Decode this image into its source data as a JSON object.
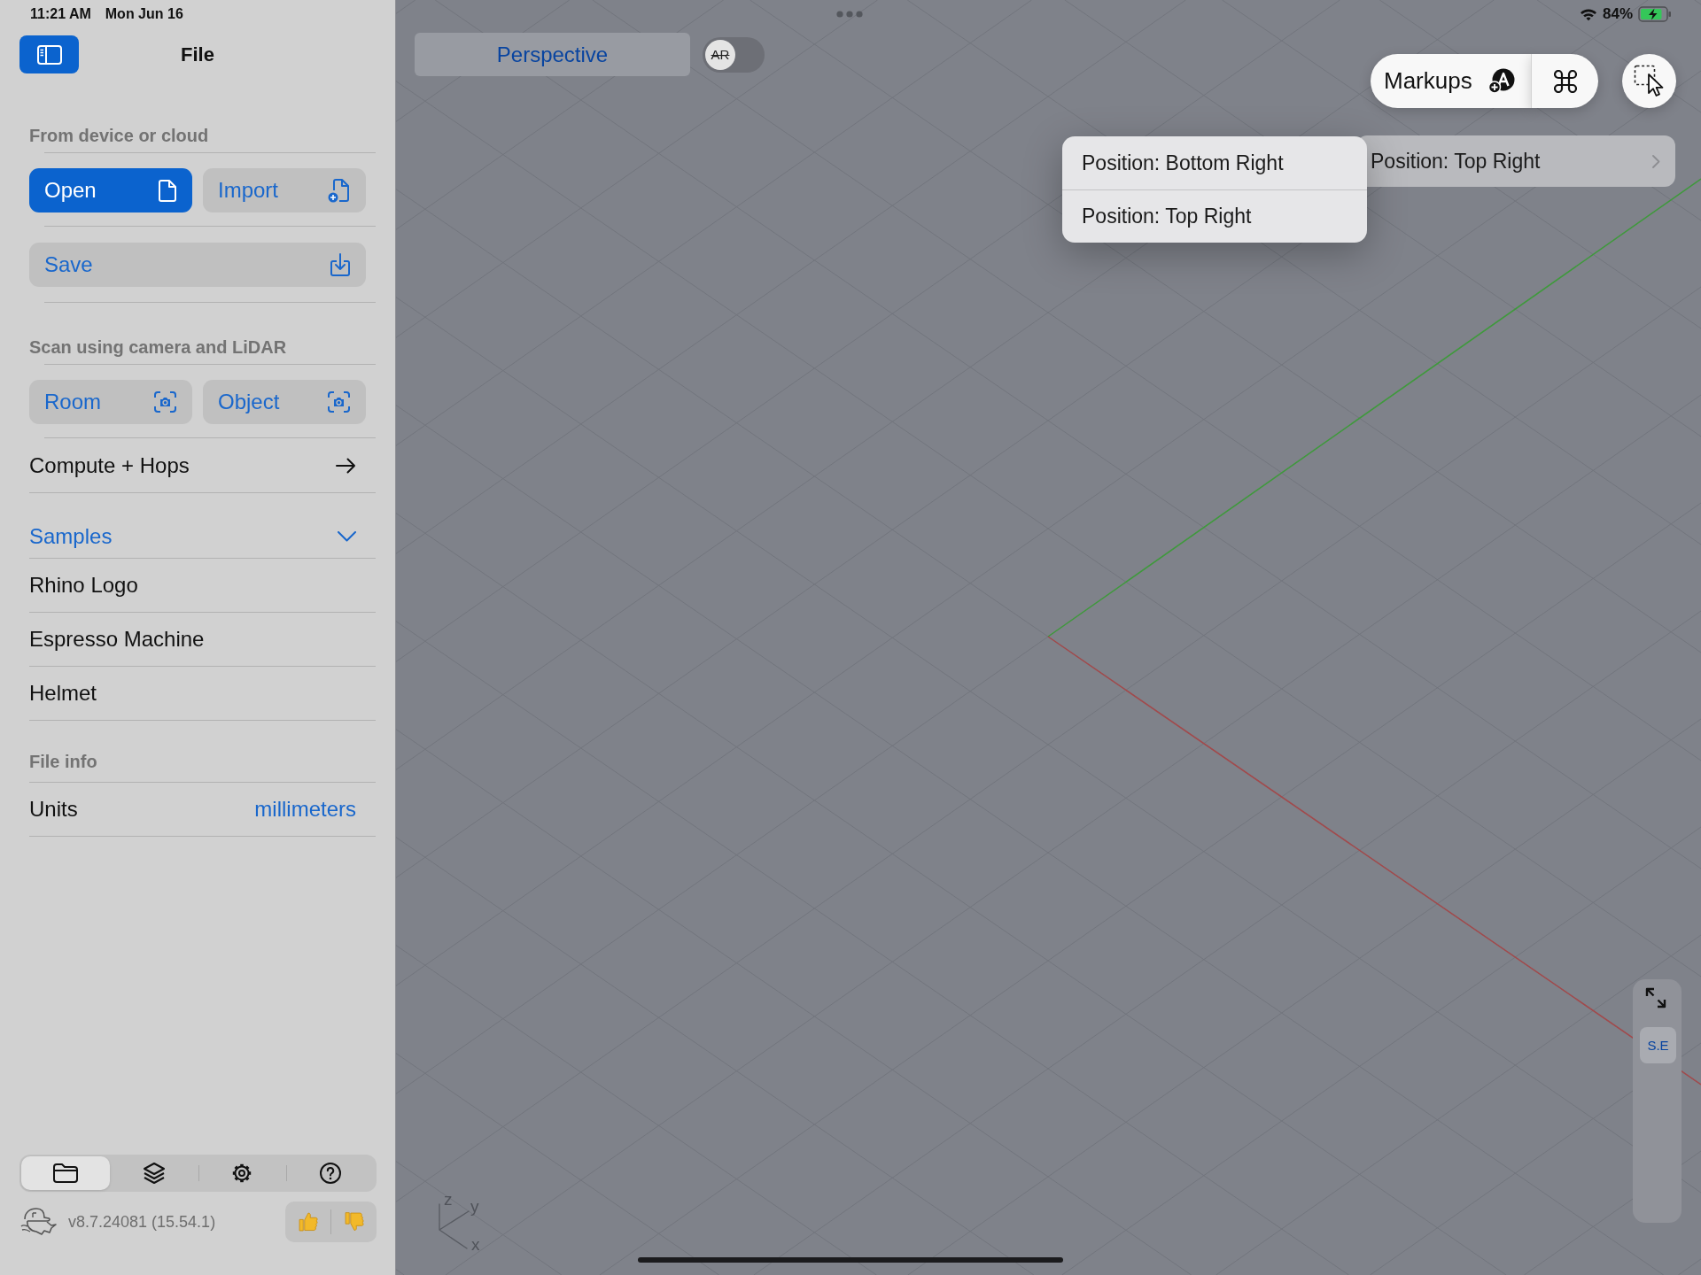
{
  "status_bar": {
    "time": "11:21 AM",
    "date": "Mon Jun 16",
    "battery": "84%"
  },
  "sidebar": {
    "title": "File",
    "device_section": {
      "header": "From device or cloud",
      "open_button": "Open",
      "import_button": "Import",
      "save_button": "Save"
    },
    "scan_section": {
      "header": "Scan using camera and LiDAR",
      "room_button": "Room",
      "object_button": "Object"
    },
    "compute_link": "Compute + Hops",
    "samples": {
      "label": "Samples",
      "expanded": true,
      "items": [
        "Rhino Logo",
        "Espresso Machine",
        "Helmet"
      ]
    },
    "file_info": {
      "header": "File info",
      "units_label": "Units",
      "units_value": "millimeters"
    },
    "bottom_tabs": [
      {
        "selected": true
      },
      {
        "selected": false
      },
      {
        "selected": false
      },
      {
        "selected": false
      }
    ],
    "version": "v8.7.24081 (15.54.1)"
  },
  "viewport": {
    "view_name": "Perspective",
    "ar_toggle": {
      "label": "AR",
      "on": false
    },
    "markups_button": "Markups",
    "submenu_parent": "Position: Top Right",
    "menu_items": [
      "Position: Bottom Right",
      "Position: Top Right"
    ],
    "axis_labels": [
      "z",
      "y",
      "x"
    ],
    "view_cube_button": "S.E"
  }
}
